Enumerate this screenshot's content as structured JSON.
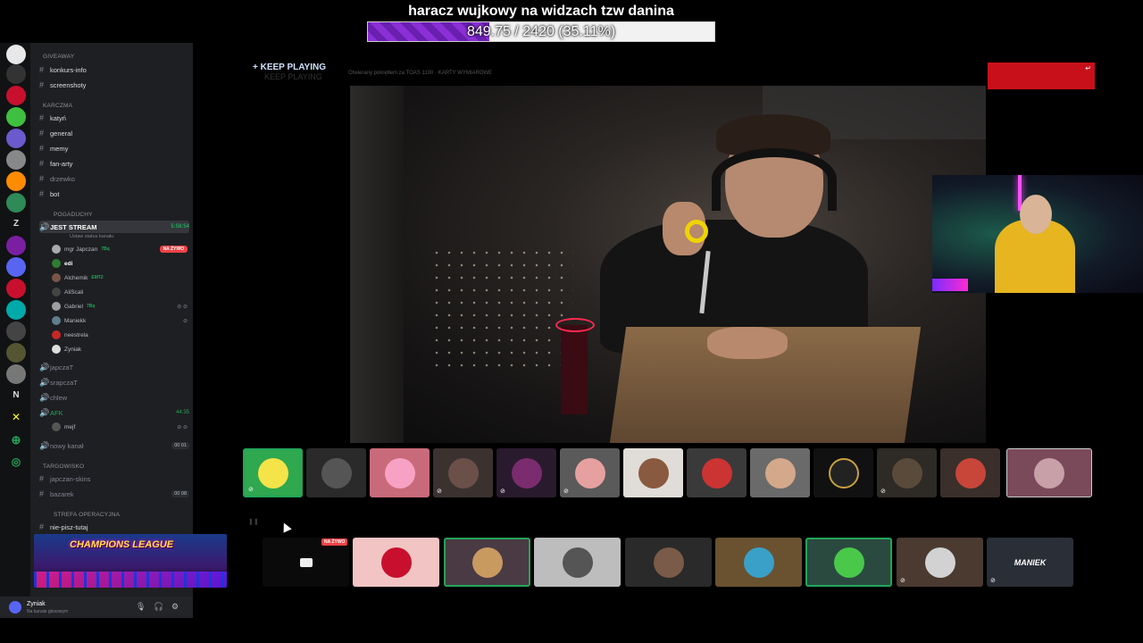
{
  "goal": {
    "title": "haracz wujkowy na widzach tzw danina",
    "progress_text": "849.75 / 2420 (35.11%)",
    "progress_fraction": 0.3511
  },
  "overlay": {
    "keep_playing": "KEEP PLAYING",
    "keep_playing_plus": "+",
    "ghost_line": "KEEP PLAYING",
    "small_text": "Otwierany pokrętłem za TOAS 1100 · KARTY WYMIAROWE",
    "redbox_icon": "exit-icon"
  },
  "server_rail": {
    "letters": [
      "Z",
      "N"
    ]
  },
  "sidebar": {
    "categories": {
      "giveaway": "GIVEAWAY",
      "karczma": "KARCZMA",
      "pogaduchy": "POGADUCHY",
      "targowisko": "TARGOWISKO",
      "strefa": "STREFA OPERACYJNA"
    },
    "channels": {
      "konkurs": "konkurs-info",
      "screenshoty": "screenshoty",
      "katyn": "katyń",
      "general": "general",
      "memy": "memy",
      "fanarty": "fan-arty",
      "drzewko": "drzewko",
      "bot": "bot",
      "jest_stream": "JEST STREAM",
      "jest_stream_time": "5:58:54",
      "jest_stream_status": "Ustaw status kanału",
      "japczat": "japczaT",
      "srapczat": "srapczaT",
      "chlew": "chlew",
      "afk": "AFK",
      "afk_time": "44:35",
      "nowy_kanal": "nowy kanał",
      "nowy_kanal_count": "00 01",
      "japczan_skins": "japczan-skins",
      "bazarek": "bazarek",
      "bazarek_count": "00 08",
      "nie_pisz": "nie-pisz-tutaj"
    },
    "users": [
      {
        "name": "mgr Japczan",
        "badge": "7Bq",
        "live": "NA ŻYWO"
      },
      {
        "name": "edi"
      },
      {
        "name": "Alchemik",
        "badge": "EMT2"
      },
      {
        "name": "AliScali"
      },
      {
        "name": "Gabriel",
        "badge": "7Bq"
      },
      {
        "name": "Maniekk"
      },
      {
        "name": "neestrela"
      },
      {
        "name": "Zyniak"
      }
    ],
    "afk_user": "mejf"
  },
  "user_panel": {
    "name": "Zyniak",
    "status": "Na kanale głosowym"
  },
  "promo": {
    "title": "CHAMPIONS LEAGUE"
  },
  "row2": {
    "live_badge": "NA ŻYWO",
    "last_tile_text": "MANIEK"
  },
  "colors": {
    "discord_bg": "#1e1f22",
    "accent_green": "#23a559",
    "live_red": "#ed4245",
    "goal_purple": "#8b2fd6"
  }
}
